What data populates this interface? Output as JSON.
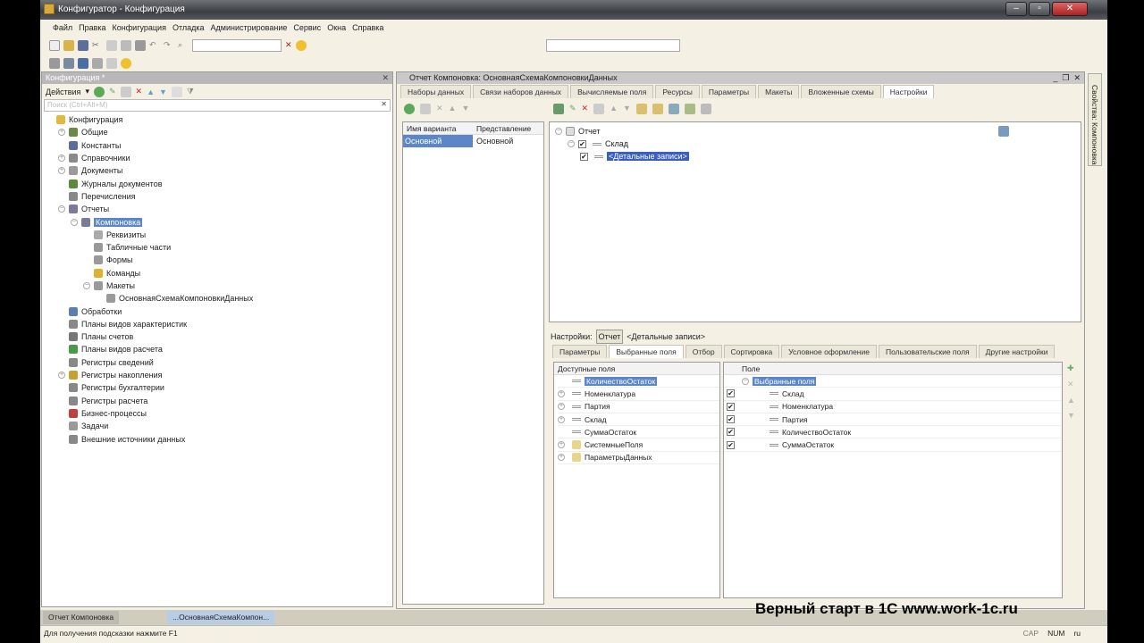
{
  "window": {
    "title": "Конфигуратор - Конфигурация"
  },
  "menu": [
    "Файл",
    "Правка",
    "Конфигурация",
    "Отладка",
    "Администрирование",
    "Сервис",
    "Окна",
    "Справка"
  ],
  "left_panel": {
    "title": "Конфигурация *",
    "actions_label": "Действия",
    "search_placeholder": "Поиск (Ctrl+Alt+M)",
    "tree": [
      {
        "label": "Конфигурация",
        "level": 0,
        "exp": "",
        "icon": "config-icon",
        "color": "#e7b73d"
      },
      {
        "label": "Общие",
        "level": 1,
        "exp": "+",
        "icon": "common-icon",
        "color": "#6a8a4a"
      },
      {
        "label": "Константы",
        "level": 1,
        "exp": "",
        "icon": "constants-icon",
        "color": "#5b6f9a"
      },
      {
        "label": "Справочники",
        "level": 1,
        "exp": "+",
        "icon": "catalogs-icon",
        "color": "#8a8a8a"
      },
      {
        "label": "Документы",
        "level": 1,
        "exp": "+",
        "icon": "documents-icon",
        "color": "#9a9a9a"
      },
      {
        "label": "Журналы документов",
        "level": 1,
        "exp": "",
        "icon": "journals-icon",
        "color": "#5a8a3a"
      },
      {
        "label": "Перечисления",
        "level": 1,
        "exp": "",
        "icon": "enums-icon",
        "color": "#888"
      },
      {
        "label": "Отчеты",
        "level": 1,
        "exp": "−",
        "icon": "reports-icon",
        "color": "#7a7a9a"
      },
      {
        "label": "Компоновка",
        "level": 2,
        "exp": "−",
        "icon": "report-icon",
        "color": "#7a7a9a",
        "selected": true
      },
      {
        "label": "Реквизиты",
        "level": 3,
        "exp": "",
        "icon": "attributes-icon",
        "color": "#aaa"
      },
      {
        "label": "Табличные части",
        "level": 3,
        "exp": "",
        "icon": "tabular-icon",
        "color": "#999"
      },
      {
        "label": "Формы",
        "level": 3,
        "exp": "",
        "icon": "forms-icon",
        "color": "#999"
      },
      {
        "label": "Команды",
        "level": 3,
        "exp": "",
        "icon": "commands-icon",
        "color": "#e0b030"
      },
      {
        "label": "Макеты",
        "level": 3,
        "exp": "−",
        "icon": "templates-icon",
        "color": "#999"
      },
      {
        "label": "ОсновнаяСхемаКомпоновкиДанных",
        "level": 4,
        "exp": "",
        "icon": "schema-icon",
        "color": "#999"
      },
      {
        "label": "Обработки",
        "level": 1,
        "exp": "",
        "icon": "processing-icon",
        "color": "#5b7fb0"
      },
      {
        "label": "Планы видов характеристик",
        "level": 1,
        "exp": "",
        "icon": "chart-char-icon",
        "color": "#888"
      },
      {
        "label": "Планы счетов",
        "level": 1,
        "exp": "",
        "icon": "accounts-icon",
        "color": "#777"
      },
      {
        "label": "Планы видов расчета",
        "level": 1,
        "exp": "",
        "icon": "calc-types-icon",
        "color": "#4a9a4a"
      },
      {
        "label": "Регистры сведений",
        "level": 1,
        "exp": "",
        "icon": "info-registers-icon",
        "color": "#888"
      },
      {
        "label": "Регистры накопления",
        "level": 1,
        "exp": "+",
        "icon": "accum-registers-icon",
        "color": "#c9a030"
      },
      {
        "label": "Регистры бухгалтерии",
        "level": 1,
        "exp": "",
        "icon": "acc-registers-icon",
        "color": "#888"
      },
      {
        "label": "Регистры расчета",
        "level": 1,
        "exp": "",
        "icon": "calc-registers-icon",
        "color": "#888"
      },
      {
        "label": "Бизнес-процессы",
        "level": 1,
        "exp": "",
        "icon": "bp-icon",
        "color": "#c04040"
      },
      {
        "label": "Задачи",
        "level": 1,
        "exp": "",
        "icon": "tasks-icon",
        "color": "#999"
      },
      {
        "label": "Внешние источники данных",
        "level": 1,
        "exp": "",
        "icon": "external-icon",
        "color": "#888"
      }
    ]
  },
  "doc": {
    "title": "Отчет Компоновка: ОсновнаяСхемаКомпоновкиДанных",
    "tabs": [
      "Наборы данных",
      "Связи наборов данных",
      "Вычисляемые поля",
      "Ресурсы",
      "Параметры",
      "Макеты",
      "Вложенные схемы",
      "Настройки"
    ],
    "variants": {
      "headers": [
        "Имя варианта",
        "Представление"
      ],
      "rows": [
        [
          "Основной",
          "Основной"
        ]
      ]
    },
    "structure": {
      "root": "Отчет",
      "group": "Склад",
      "details": "<Детальные записи>"
    },
    "settings_label": "Настройки:",
    "settings_crumb": [
      "Отчет",
      "<Детальные записи>"
    ],
    "settings_tabs": [
      "Параметры",
      "Выбранные поля",
      "Отбор",
      "Сортировка",
      "Условное оформление",
      "Пользовательские поля",
      "Другие настройки"
    ],
    "available": {
      "header": "Доступные поля",
      "items": [
        {
          "label": "КоличествоОстаток",
          "exp": "",
          "folder": false,
          "selected": true
        },
        {
          "label": "Номенклатура",
          "exp": "+",
          "folder": false
        },
        {
          "label": "Партия",
          "exp": "+",
          "folder": false
        },
        {
          "label": "Склад",
          "exp": "+",
          "folder": false
        },
        {
          "label": "СуммаОстаток",
          "exp": "",
          "folder": false
        },
        {
          "label": "СистемныеПоля",
          "exp": "+",
          "folder": true
        },
        {
          "label": "ПараметрыДанных",
          "exp": "+",
          "folder": true
        }
      ]
    },
    "selected": {
      "header": "Поле",
      "group": "Выбранные поля",
      "items": [
        "Склад",
        "Номенклатура",
        "Партия",
        "КоличествоОстаток",
        "СуммаОстаток"
      ]
    }
  },
  "side_panel": {
    "label": "Свойства: Компоновка"
  },
  "taskbar": [
    "Отчет Компоновка",
    "...ОсновнаяСхемаКомпон..."
  ],
  "status": {
    "hint": "Для получения подсказки нажмите F1",
    "indicators": [
      "CAP",
      "NUM",
      "ru"
    ]
  },
  "watermark": "Верный старт в 1С www.work-1c.ru"
}
